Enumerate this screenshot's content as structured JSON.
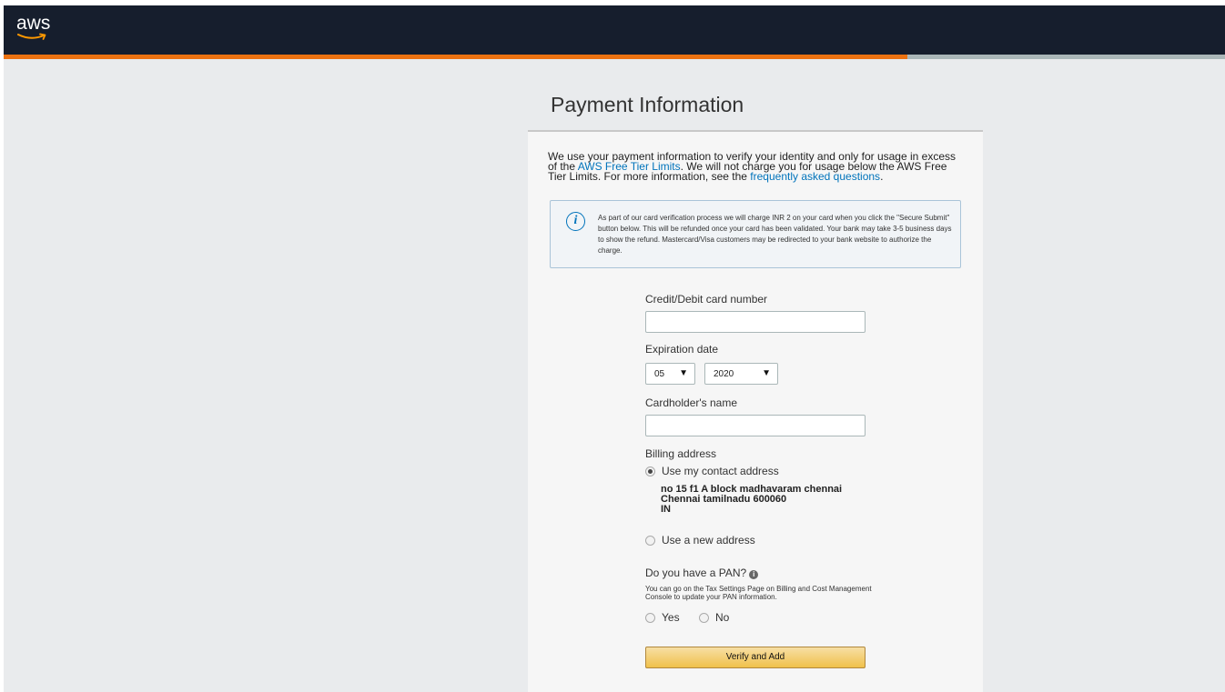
{
  "brand": {
    "logo_text": "aws",
    "accent_color": "#ec7211",
    "header_color": "#161e2d"
  },
  "progress": {
    "fraction": 0.74
  },
  "page": {
    "title": "Payment Information"
  },
  "intro": {
    "text_1": "We use your payment information to verify your identity and only for usage in excess of the ",
    "link_free_tier": "AWS Free Tier Limits",
    "text_2": ". We will not charge you for usage below the AWS Free Tier Limits. For more information, see the ",
    "link_faq": "frequently asked questions",
    "text_3": "."
  },
  "info_box": {
    "icon": "info-icon",
    "text": "As part of our card verification process we will charge INR 2 on your card when you click the \"Secure Submit\" button below. This will be refunded once your card has been validated. Your bank may take 3-5 business days to show the refund. Mastercard/Visa customers may be redirected to your bank website to authorize the charge."
  },
  "form": {
    "card_number_label": "Credit/Debit card number",
    "card_number_value": "",
    "expiration_label": "Expiration date",
    "exp_month": "05",
    "exp_year": "2020",
    "cardholder_label": "Cardholder's name",
    "cardholder_value": "",
    "billing_label": "Billing address",
    "use_contact_label": "Use my contact address",
    "address_line1": "no 15 f1 A block madhavaram chennai",
    "address_line2": "Chennai tamilnadu 600060",
    "address_line3": "IN",
    "use_new_label": "Use a new address",
    "pan_question": "Do you have a PAN?",
    "pan_note": "You can go on the Tax Settings Page on Billing and Cost Management Console to update your PAN information.",
    "pan_yes": "Yes",
    "pan_no": "No",
    "submit_label": "Verify and Add"
  }
}
